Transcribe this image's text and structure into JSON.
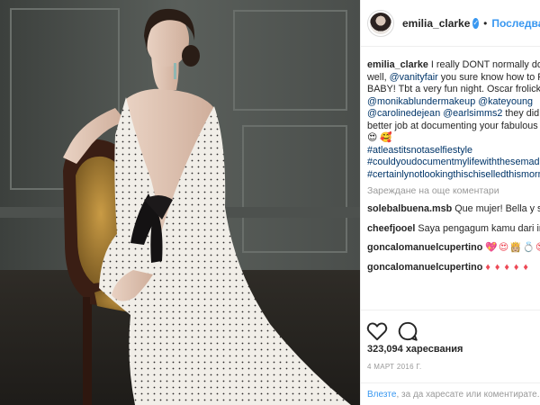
{
  "header": {
    "username": "emilia_clarke",
    "separator": "•",
    "follow_label": "Последване",
    "verified_glyph": "✓"
  },
  "caption": {
    "username": "emilia_clarke",
    "text1": " I really DONT normally do these but, well, ",
    "mention_vanityfair": "@vanityfair",
    "text2": " you sure know how to FILTER BABY! Tbt a very fun night. Oscar frolicking indeed...\n",
    "mentions_line1": "@monikablundermakeup @kateyoung\n@carolinedejean @earlsimms2",
    "text3": " they did a much better job at documenting your fabulous handy work 😍 🥰",
    "hashtags": "\n#atleastitsnotaselfiestyle\n#couldyoudocumentmylifewiththesemadphotographicskilsplease?\n#certainlynotlookingthischiselledthismorning"
  },
  "load_more_label": "Зареждане на още коментари",
  "comments": [
    {
      "username": "solebalbuena.msb",
      "text": " Que mujer! Bella y sexy!",
      "emoji": ""
    },
    {
      "username": "cheefjooel",
      "text": " Saya pengagum kamu dari indonesia",
      "emoji": ""
    },
    {
      "username": "goncalomanuelcupertino",
      "text": " ",
      "emoji": "💖😍👸🏼💍😍"
    },
    {
      "username": "goncalomanuelcupertino",
      "text": " ",
      "emoji": "♦ ♦ ♦ ♦ ♦"
    }
  ],
  "likes_label": "323,094 харесвания",
  "date_label": "4 МАРТ 2016 Г.",
  "login": {
    "link": "Влезте",
    "text": ", за да харесате или коментирате."
  },
  "icons": {
    "like": "heart-icon",
    "comment": "comment-bubble-icon",
    "verified": "verified-badge-icon"
  },
  "colors": {
    "accent": "#3897f0",
    "border": "#efefef",
    "muted": "#999999",
    "dress": "#f2efe9",
    "chair_wood": "#3a1e14",
    "cushion": "#b58a3a"
  }
}
